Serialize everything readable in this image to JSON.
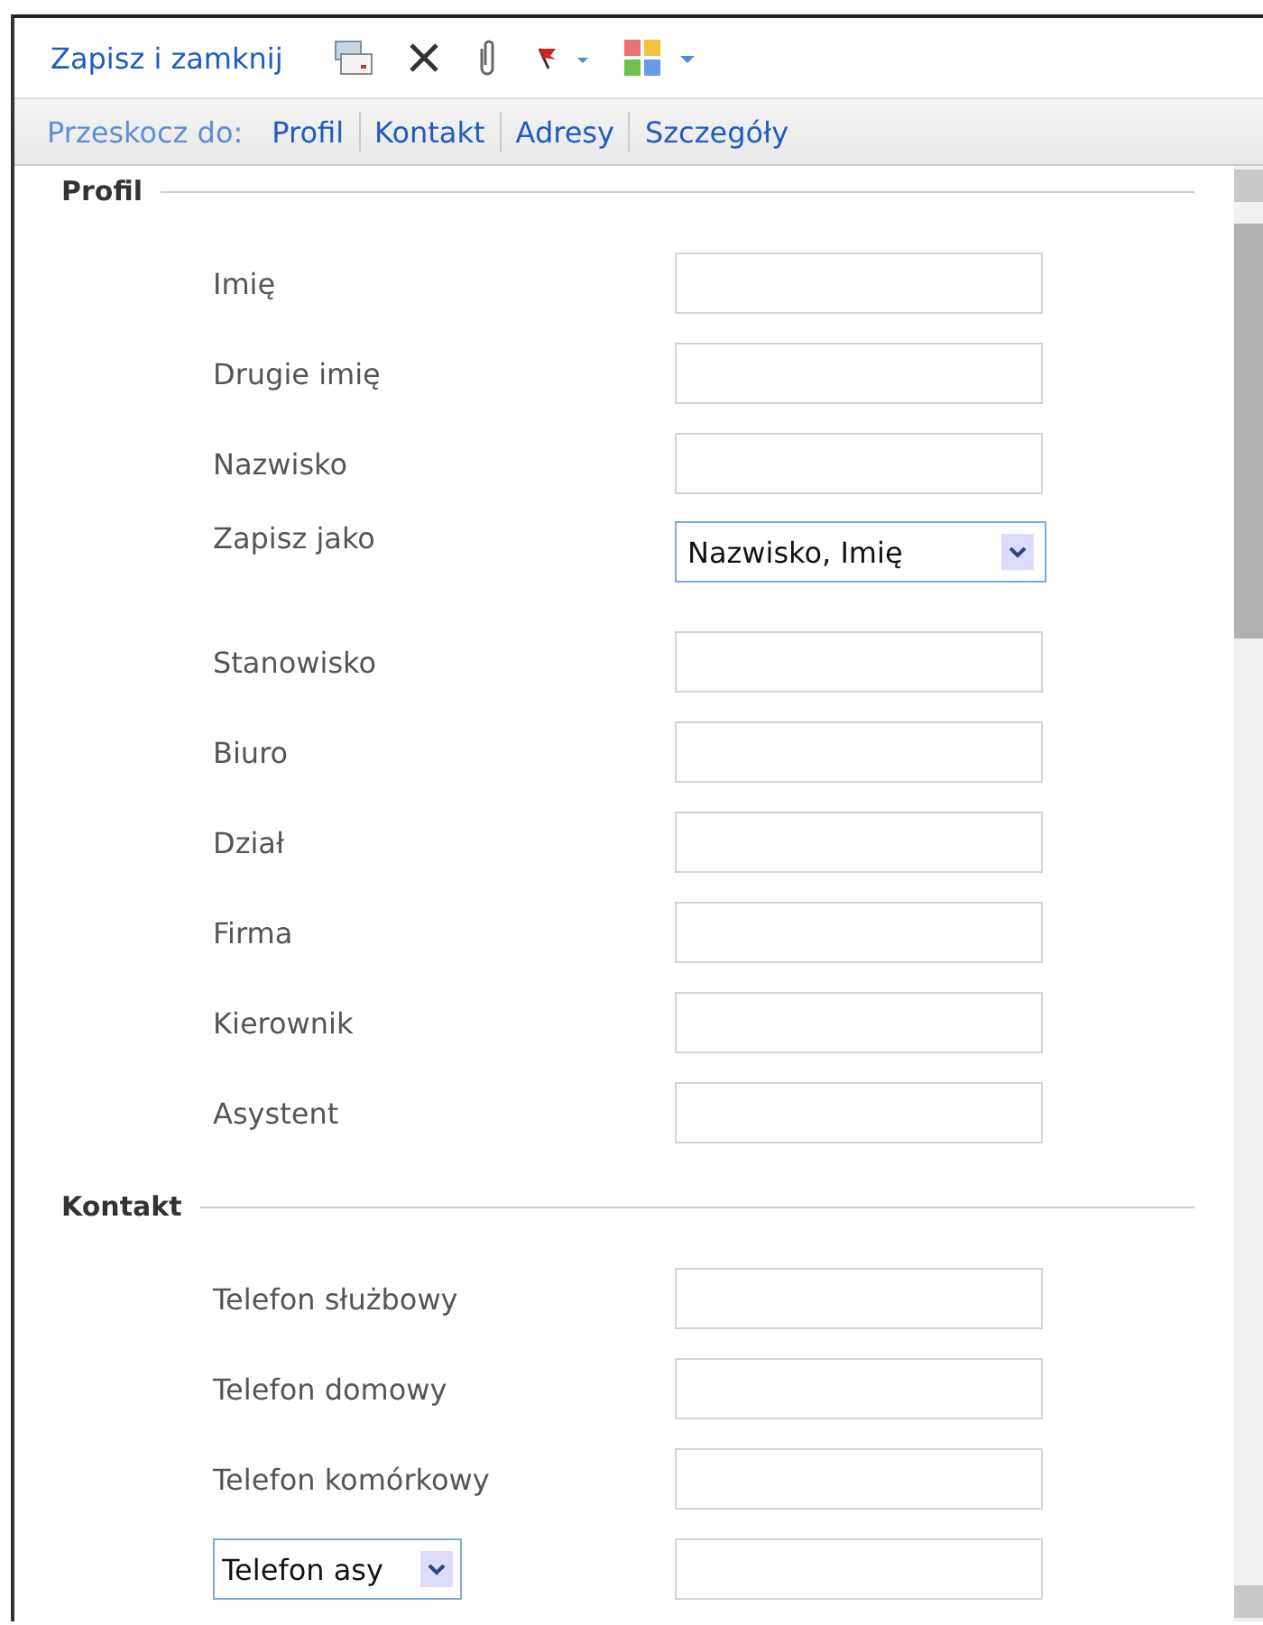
{
  "toolbar": {
    "save_label": "Zapisz i zamknij"
  },
  "jump_bar": {
    "label": "Przeskocz do:",
    "links": [
      "Profil",
      "Kontakt",
      "Adresy",
      "Szczegóły"
    ]
  },
  "sections": [
    {
      "title": "Profil",
      "fields": [
        {
          "kind": "text",
          "label": "Imię"
        },
        {
          "kind": "text",
          "label": "Drugie imię"
        },
        {
          "kind": "text",
          "label": "Nazwisko"
        },
        {
          "kind": "select",
          "label": "Zapisz jako",
          "value": "Nazwisko, Imię"
        },
        {
          "kind": "text",
          "label": "Stanowisko"
        },
        {
          "kind": "text",
          "label": "Biuro"
        },
        {
          "kind": "text",
          "label": "Dział"
        },
        {
          "kind": "text",
          "label": "Firma"
        },
        {
          "kind": "text",
          "label": "Kierownik"
        },
        {
          "kind": "text",
          "label": "Asystent"
        }
      ]
    },
    {
      "title": "Kontakt",
      "fields": [
        {
          "kind": "text",
          "label": "Telefon służbowy"
        },
        {
          "kind": "text",
          "label": "Telefon domowy"
        },
        {
          "kind": "text",
          "label": "Telefon komórkowy"
        },
        {
          "kind": "label-select",
          "label": "Telefon asy"
        }
      ]
    }
  ]
}
